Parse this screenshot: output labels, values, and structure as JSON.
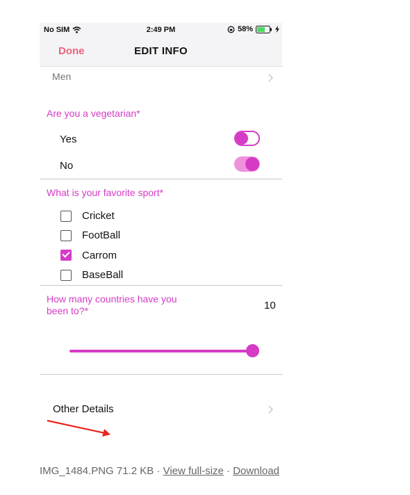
{
  "status_bar": {
    "carrier": "No SIM",
    "time": "2:49 PM",
    "battery": "58%"
  },
  "nav": {
    "done_label": "Done",
    "title": "EDIT INFO"
  },
  "gender_row": {
    "value": "Men"
  },
  "vegetarian": {
    "question": "Are you a vegetarian*",
    "options": [
      {
        "label": "Yes",
        "toggle": "off"
      },
      {
        "label": "No",
        "toggle": "on"
      }
    ]
  },
  "sport": {
    "question": "What is your favorite sport*",
    "options": [
      {
        "label": "Cricket",
        "checked": false
      },
      {
        "label": "FootBall",
        "checked": false
      },
      {
        "label": "Carrom",
        "checked": true
      },
      {
        "label": "BaseBall",
        "checked": false
      }
    ]
  },
  "countries": {
    "question_line1": "How many countries have you",
    "question_line2": "been to?*",
    "value": "10",
    "slider_fraction": 1.0
  },
  "other_details": {
    "label": "Other Details"
  },
  "footer": {
    "file_info": "IMG_1484.PNG 71.2 KB",
    "sep": " · ",
    "view_link": "View full-size",
    "download_link": "Download"
  },
  "colors": {
    "accent": "#d63bc6",
    "done": "#f0627d",
    "arrow": "#e8261e"
  },
  "icons": [
    "wifi-icon",
    "orientation-lock-icon",
    "battery-icon",
    "charging-icon",
    "chevron-right-icon",
    "checkmark-icon",
    "red-arrow-annotation"
  ]
}
